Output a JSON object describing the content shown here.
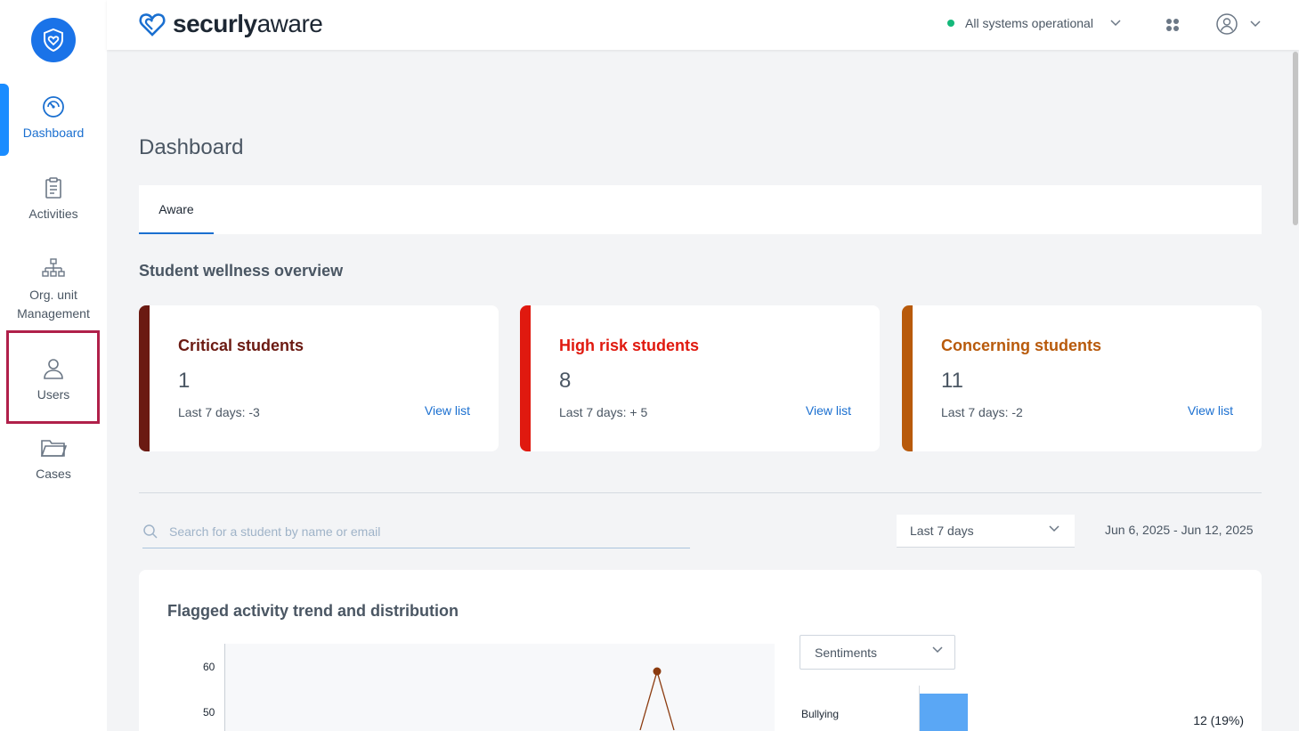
{
  "brand": {
    "name_bold": "securly",
    "name_light": "aware"
  },
  "sidebar": {
    "items": [
      {
        "label": "Dashboard",
        "icon": "gauge-icon"
      },
      {
        "label": "Activities",
        "icon": "clipboard-icon"
      },
      {
        "label": "Org. unit Management",
        "icon": "org-chart-icon"
      },
      {
        "label": "Users",
        "icon": "user-icon"
      },
      {
        "label": "Cases",
        "icon": "folder-icon"
      }
    ]
  },
  "header": {
    "status_text": "All systems operational",
    "status_color": "#14b87a"
  },
  "page": {
    "title": "Dashboard"
  },
  "tabs": [
    {
      "label": "Aware"
    }
  ],
  "overview": {
    "title": "Student wellness overview",
    "cards": [
      {
        "title": "Critical students",
        "count": "1",
        "delta": "Last 7 days: -3",
        "link": "View list",
        "color": "#6b1a12"
      },
      {
        "title": "High risk students",
        "count": "8",
        "delta": "Last 7 days: + 5",
        "link": "View list",
        "color": "#e0190f"
      },
      {
        "title": "Concerning students",
        "count": "11",
        "delta": "Last 7 days: -2",
        "link": "View list",
        "color": "#b85a0b"
      }
    ]
  },
  "filters": {
    "search_placeholder": "Search for a student by name or email",
    "period": "Last 7 days",
    "date_range": "Jun 6, 2025 - Jun 12, 2025"
  },
  "activity_panel": {
    "title": "Flagged activity trend and distribution",
    "dropdown": "Sentiments"
  },
  "chart_data": [
    {
      "type": "line",
      "yticks": [
        "60",
        "50"
      ],
      "series": [
        {
          "values_visible": [
            59
          ],
          "color": "#8b3a0e"
        }
      ]
    },
    {
      "type": "bar",
      "categories": [
        "Bullying"
      ],
      "values": [
        12
      ],
      "value_labels": [
        "12 (19%)"
      ],
      "color": "#5aa7f5"
    }
  ]
}
